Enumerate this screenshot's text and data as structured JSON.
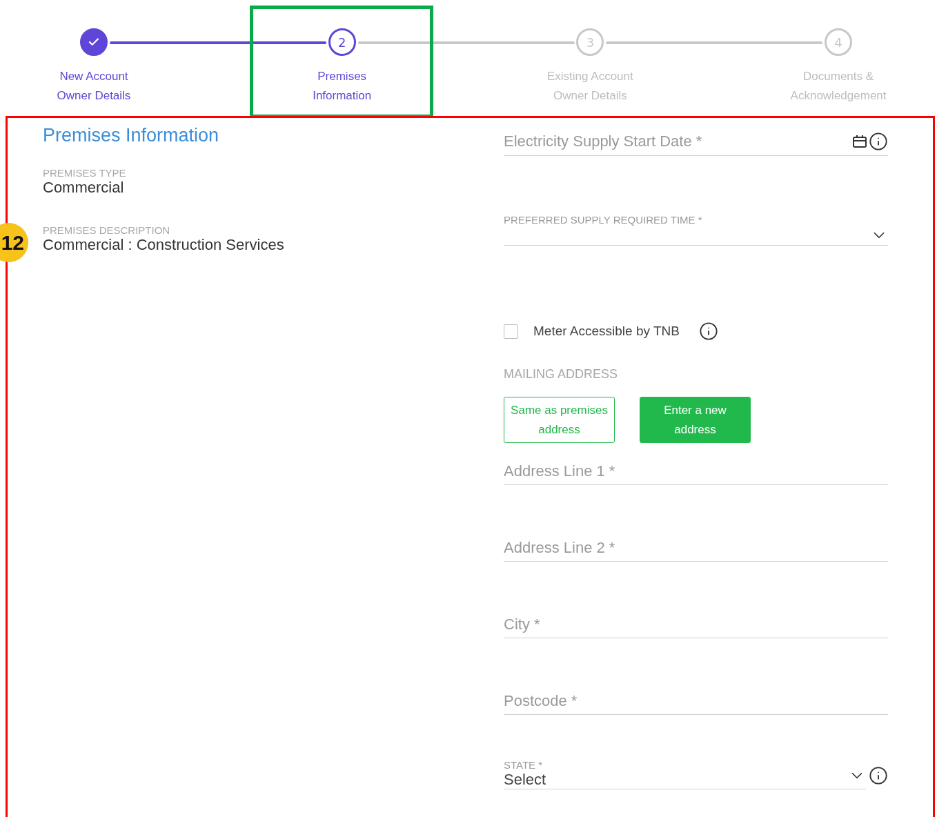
{
  "stepper": {
    "steps": [
      {
        "completed": true,
        "selected": false,
        "label_lines": [
          "New Account",
          "Owner Details"
        ]
      },
      {
        "number": "2",
        "completed": false,
        "selected": true,
        "label_lines": [
          "Premises",
          "Information"
        ]
      },
      {
        "number": "3",
        "completed": false,
        "selected": false,
        "label_lines": [
          "Existing Account",
          "Owner Details"
        ]
      },
      {
        "number": "4",
        "completed": false,
        "selected": false,
        "label_lines": [
          "Documents &",
          "Acknowledgement"
        ]
      }
    ]
  },
  "annotation_badge": "12",
  "summary": {
    "title": "Premises Information",
    "items": [
      {
        "label": "PREMISES TYPE",
        "value": "Commercial"
      },
      {
        "label": "PREMISES DESCRIPTION",
        "value": "Commercial : Construction Services"
      }
    ]
  },
  "form": {
    "fields": [
      {
        "kind": "date",
        "placeholder": "Electricity Supply Start Date *"
      },
      {
        "kind": "select",
        "label": "PREFERRED SUPPLY REQUIRED TIME *"
      },
      {
        "kind": "checkbox",
        "label": "Meter Accessible by TNB",
        "checked": false
      },
      {
        "kind": "section",
        "label": "MAILING ADDRESS"
      },
      {
        "kind": "choice",
        "options": [
          {
            "label": "Same as premises address",
            "selected": false
          },
          {
            "label": "Enter a new address",
            "selected": true
          }
        ]
      },
      {
        "kind": "text",
        "placeholder": "Address Line 1 *"
      },
      {
        "kind": "text",
        "placeholder": "Address Line 2 *"
      },
      {
        "kind": "text",
        "placeholder": "City *"
      },
      {
        "kind": "text",
        "placeholder": "Postcode *"
      },
      {
        "kind": "state",
        "label": "STATE *",
        "value": "Select"
      }
    ]
  }
}
